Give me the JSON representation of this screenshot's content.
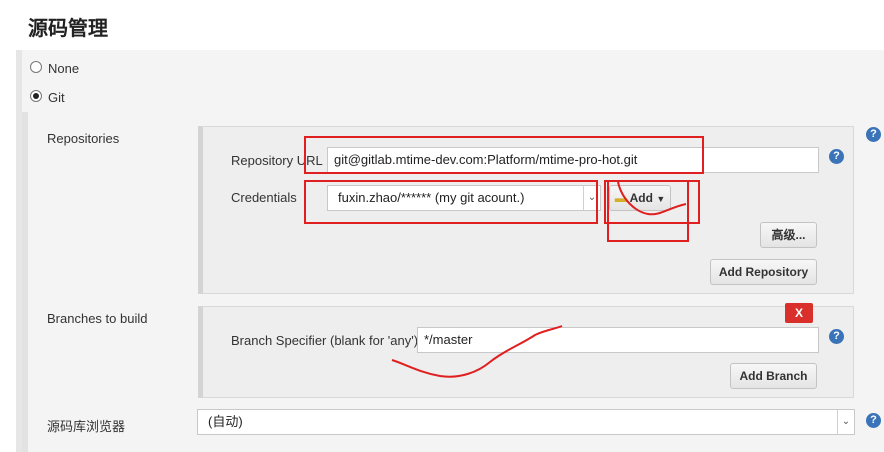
{
  "section_title": "源码管理",
  "scm_options": [
    {
      "label": "None",
      "checked": false
    },
    {
      "label": "Git",
      "checked": true
    }
  ],
  "repositories": {
    "label": "Repositories",
    "url_label": "Repository URL",
    "url_value": "git@gitlab.mtime-dev.com:Platform/mtime-pro-hot.git",
    "credentials_label": "Credentials",
    "credentials_value": "fuxin.zhao/****** (my git acount.)",
    "add_button": "Add",
    "advanced_button": "高级...",
    "add_repository_button": "Add Repository"
  },
  "branches": {
    "label": "Branches to build",
    "delete_button": "X",
    "specifier_label": "Branch Specifier (blank for 'any')",
    "specifier_value": "*/master",
    "add_branch_button": "Add Branch"
  },
  "browser": {
    "label": "源码库浏览器",
    "value": "(自动)"
  },
  "help_icon_text": "?",
  "colors": {
    "annotation_red": "#e02020",
    "help_blue": "#3a73b8",
    "delete_red": "#d9302c"
  }
}
